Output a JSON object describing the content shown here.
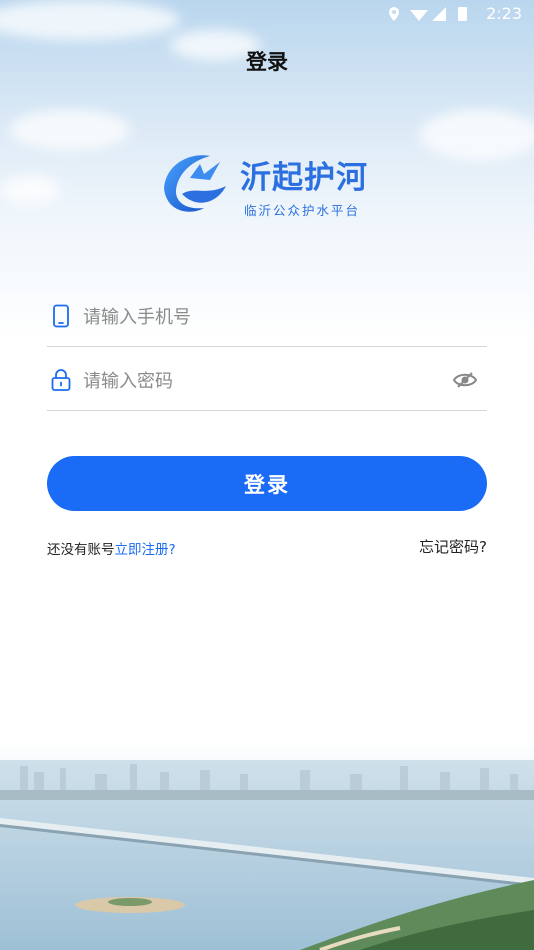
{
  "status_bar": {
    "time": "2:23",
    "icons": [
      "location-icon",
      "wifi-icon",
      "signal-icon",
      "battery-icon"
    ]
  },
  "header": {
    "title": "登录"
  },
  "logo": {
    "name": "沂起护河",
    "subtitle": "临沂公众护水平台"
  },
  "form": {
    "phone": {
      "placeholder": "请输入手机号",
      "value": ""
    },
    "password": {
      "placeholder": "请输入密码",
      "value": ""
    },
    "login_label": "登录"
  },
  "links": {
    "register_prompt": "还没有账号",
    "register_link": "立即注册?",
    "forgot_password": "忘记密码?"
  },
  "colors": {
    "primary": "#1a6bf5",
    "logo_blue": "#2b6fe0"
  }
}
